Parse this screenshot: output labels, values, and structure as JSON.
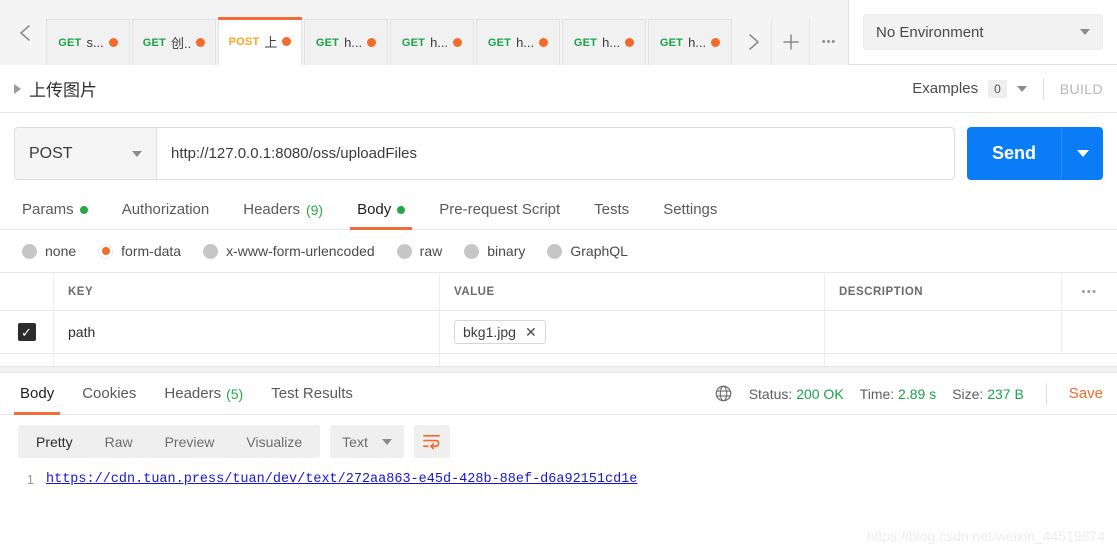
{
  "topbar": {
    "back_icon": "arrow-left-icon",
    "tabs": [
      {
        "method": "GET",
        "name": "s...",
        "unsaved": true,
        "active": false
      },
      {
        "method": "GET",
        "name": "创..",
        "unsaved": true,
        "active": false
      },
      {
        "method": "POST",
        "name": "上",
        "unsaved": true,
        "active": true
      },
      {
        "method": "GET",
        "name": "h...",
        "unsaved": true,
        "active": false
      },
      {
        "method": "GET",
        "name": "h...",
        "unsaved": true,
        "active": false
      },
      {
        "method": "GET",
        "name": "h...",
        "unsaved": true,
        "active": false
      },
      {
        "method": "GET",
        "name": "h...",
        "unsaved": true,
        "active": false
      },
      {
        "method": "GET",
        "name": "h...",
        "unsaved": true,
        "active": false
      }
    ],
    "forward_icon": "arrow-right-icon",
    "new_tab_icon": "plus-icon",
    "more_icon": "ellipsis-icon",
    "environment": "No Environment"
  },
  "breadcrumb": {
    "title": "上传图片",
    "examples_label": "Examples",
    "examples_count": "0",
    "build_label": "BUILD"
  },
  "request": {
    "method": "POST",
    "url": "http://127.0.0.1:8080/oss/uploadFiles",
    "send_label": "Send"
  },
  "request_tabs": [
    {
      "label": "Params",
      "dot": true,
      "count": "",
      "active": false
    },
    {
      "label": "Authorization",
      "dot": false,
      "count": "",
      "active": false
    },
    {
      "label": "Headers",
      "dot": false,
      "count": "(9)",
      "active": false
    },
    {
      "label": "Body",
      "dot": true,
      "count": "",
      "active": true
    },
    {
      "label": "Pre-request Script",
      "dot": false,
      "count": "",
      "active": false
    },
    {
      "label": "Tests",
      "dot": false,
      "count": "",
      "active": false
    },
    {
      "label": "Settings",
      "dot": false,
      "count": "",
      "active": false
    }
  ],
  "body_types": [
    {
      "label": "none",
      "selected": false
    },
    {
      "label": "form-data",
      "selected": true
    },
    {
      "label": "x-www-form-urlencoded",
      "selected": false
    },
    {
      "label": "raw",
      "selected": false
    },
    {
      "label": "binary",
      "selected": false
    },
    {
      "label": "GraphQL",
      "selected": false
    }
  ],
  "kv_table": {
    "headers": {
      "key": "KEY",
      "value": "VALUE",
      "description": "DESCRIPTION",
      "more": "•••"
    },
    "rows": [
      {
        "checked": true,
        "key": "path",
        "value": "bkg1.jpg",
        "remove_label": "✕",
        "description": ""
      }
    ]
  },
  "response": {
    "tabs": [
      {
        "label": "Body",
        "count": "",
        "active": true
      },
      {
        "label": "Cookies",
        "count": "",
        "active": false
      },
      {
        "label": "Headers",
        "count": "(5)",
        "active": false
      },
      {
        "label": "Test Results",
        "count": "",
        "active": false
      }
    ],
    "globe_icon": "globe-icon",
    "status_label": "Status:",
    "status_value": "200 OK",
    "time_label": "Time:",
    "time_value": "2.89 s",
    "size_label": "Size:",
    "size_value": "237 B",
    "save_label": "Save",
    "view_modes": [
      {
        "label": "Pretty",
        "active": true
      },
      {
        "label": "Raw",
        "active": false
      },
      {
        "label": "Preview",
        "active": false
      },
      {
        "label": "Visualize",
        "active": false
      }
    ],
    "format": "Text",
    "wrap_icon": "wrap-lines-icon",
    "body_lines": [
      {
        "number": "1",
        "text": "https://cdn.tuan.press/tuan/dev/text/272aa863-e45d-428b-88ef-d6a92151cd1e"
      }
    ]
  },
  "watermark": "https://blog.csdn.net/weixin_44519874",
  "colors": {
    "accent_orange": "#f26b3a",
    "send_blue": "#0a7cf5",
    "success_green": "#1aa34a",
    "get_green": "#1aa34a",
    "post_amber": "#f5a623"
  }
}
